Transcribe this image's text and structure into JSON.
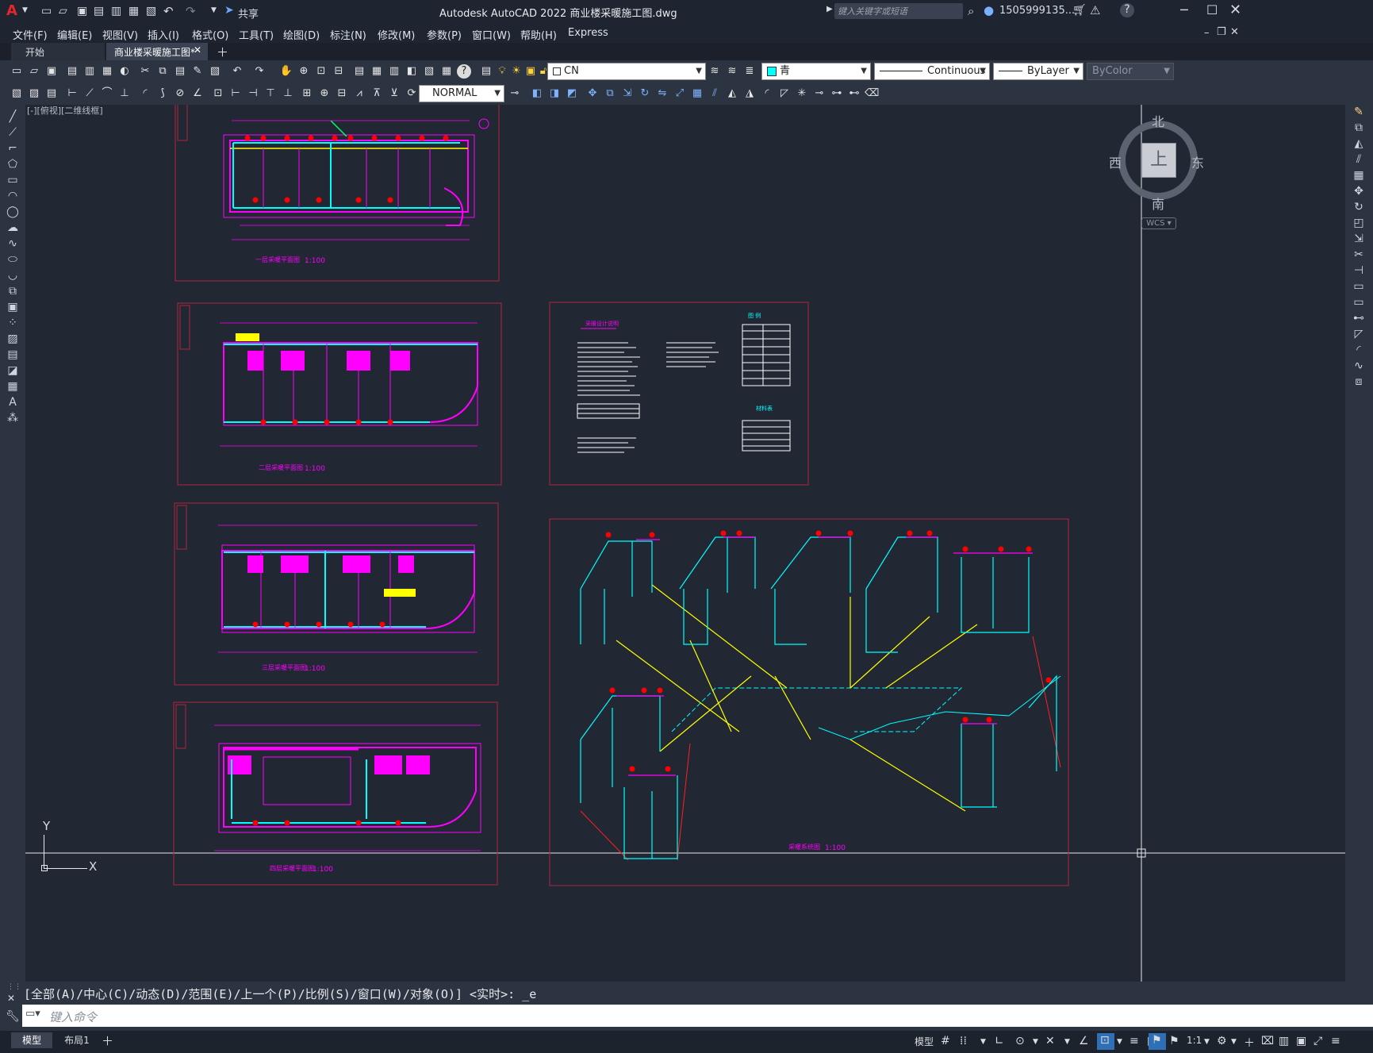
{
  "app": {
    "title": "Autodesk AutoCAD 2022    商业楼采暖施工图.dwg",
    "logo": "A",
    "share": "共享",
    "search_placeholder": "键入关键字或短语",
    "user": "1505999135...",
    "help": "?"
  },
  "menu": [
    "文件(F)",
    "编辑(E)",
    "视图(V)",
    "插入(I)",
    "格式(O)",
    "工具(T)",
    "绘图(D)",
    "标注(N)",
    "修改(M)",
    "参数(P)",
    "窗口(W)",
    "帮助(H)",
    "Express"
  ],
  "tabs": [
    {
      "label": "开始",
      "active": false
    },
    {
      "label": "商业楼采暖施工图*",
      "active": true
    }
  ],
  "toolbar": {
    "layer_value": "CN",
    "color_value": "青",
    "linetype_value": "Continuous",
    "lineweight_value": "ByLayer",
    "plotstyle_value": "ByColor",
    "textstyle_value": "NORMAL"
  },
  "viewport": {
    "label": "[-][俯视][二维线框]",
    "compass": {
      "north": "北",
      "south": "南",
      "east": "东",
      "west": "西",
      "top": "上"
    },
    "wcs": "WCS",
    "ucs_x": "X",
    "ucs_y": "Y"
  },
  "sheets": [
    {
      "title": "一层采暖平面图",
      "scale": "1:100"
    },
    {
      "title": "二层采暖平面图",
      "scale": "1:100"
    },
    {
      "title": "三层采暖平面图",
      "scale": "1:100"
    },
    {
      "title": "四层采暖平面图",
      "scale": "1:100"
    },
    {
      "title": "采暖设计说明",
      "scale": ""
    },
    {
      "title": "采暖系统图",
      "scale": "1:100"
    }
  ],
  "legend": {
    "title1": "图 例",
    "title2": "材料表"
  },
  "command": {
    "history": "[全部(A)/中心(C)/动态(D)/范围(E)/上一个(P)/比例(S)/窗口(W)/对象(O)] <实时>: _e",
    "input_placeholder": "键入命令"
  },
  "status": {
    "layout_tabs": [
      "模型",
      "布局1"
    ],
    "model_label": "模型",
    "scale": "1:1"
  },
  "colors": {
    "magenta": "#ff00ff",
    "cyan": "#00ffff",
    "yellow": "#ffff00",
    "red": "#ff0000",
    "frame": "#b0243c",
    "canvas": "#212733"
  }
}
